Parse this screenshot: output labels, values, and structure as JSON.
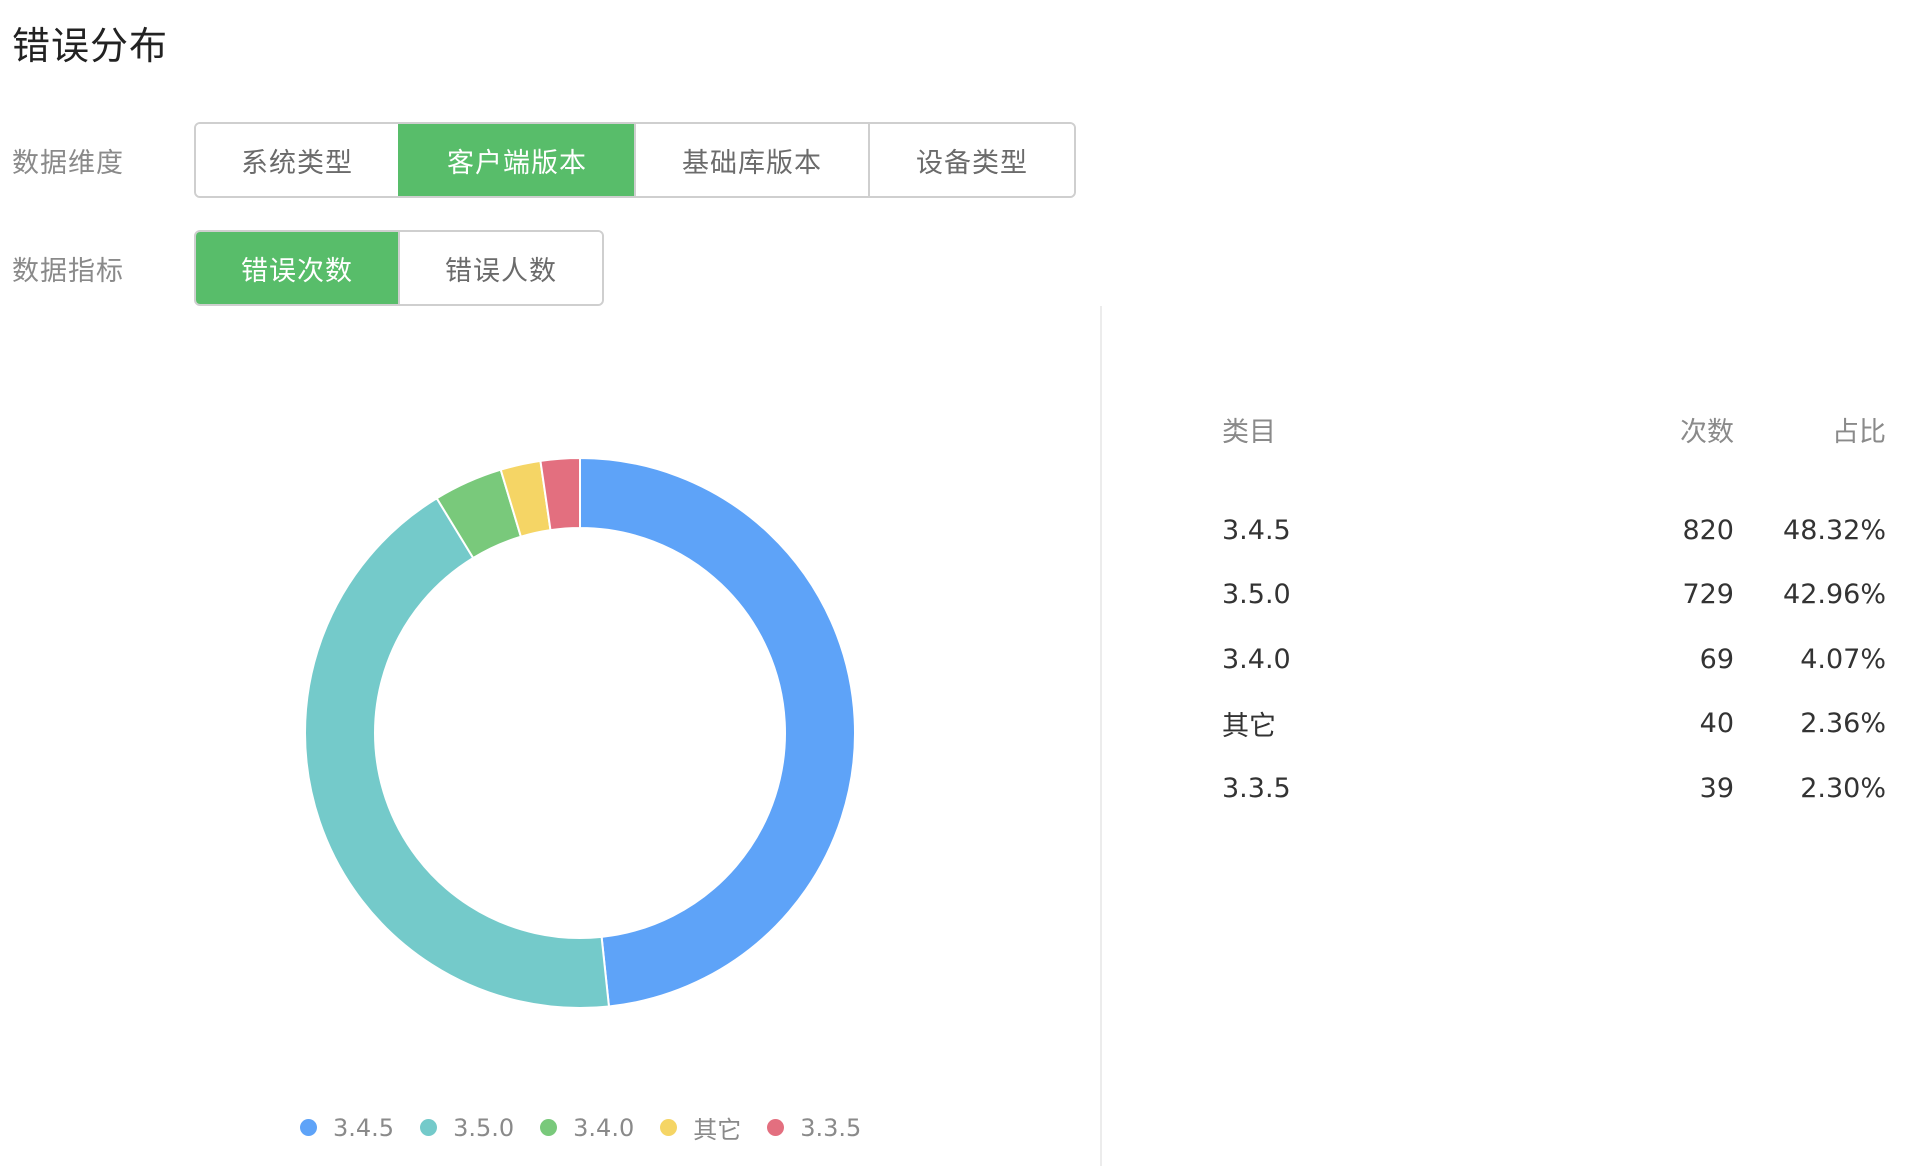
{
  "title": "错误分布",
  "filters": {
    "dimension": {
      "label": "数据维度",
      "options": [
        "系统类型",
        "客户端版本",
        "基础库版本",
        "设备类型"
      ],
      "active": 1
    },
    "metric": {
      "label": "数据指标",
      "options": [
        "错误次数",
        "错误人数"
      ],
      "active": 0
    }
  },
  "colors": {
    "accent": "#58bd6a"
  },
  "chart_data": {
    "type": "pie",
    "donut": true,
    "categories": [
      "3.4.5",
      "3.5.0",
      "3.4.0",
      "其它",
      "3.3.5"
    ],
    "values": [
      820,
      729,
      69,
      40,
      39
    ],
    "colors": [
      "#5ea3f8",
      "#74caca",
      "#79c97b",
      "#f5d565",
      "#e36f7f"
    ],
    "legend": "bottom"
  },
  "table": {
    "headers": {
      "category": "类目",
      "count": "次数",
      "percent": "占比"
    },
    "rows": [
      {
        "category": "3.4.5",
        "count": "820",
        "percent": "48.32%"
      },
      {
        "category": "3.5.0",
        "count": "729",
        "percent": "42.96%"
      },
      {
        "category": "3.4.0",
        "count": "69",
        "percent": "4.07%"
      },
      {
        "category": "其它",
        "count": "40",
        "percent": "2.36%"
      },
      {
        "category": "3.3.5",
        "count": "39",
        "percent": "2.30%"
      }
    ]
  }
}
